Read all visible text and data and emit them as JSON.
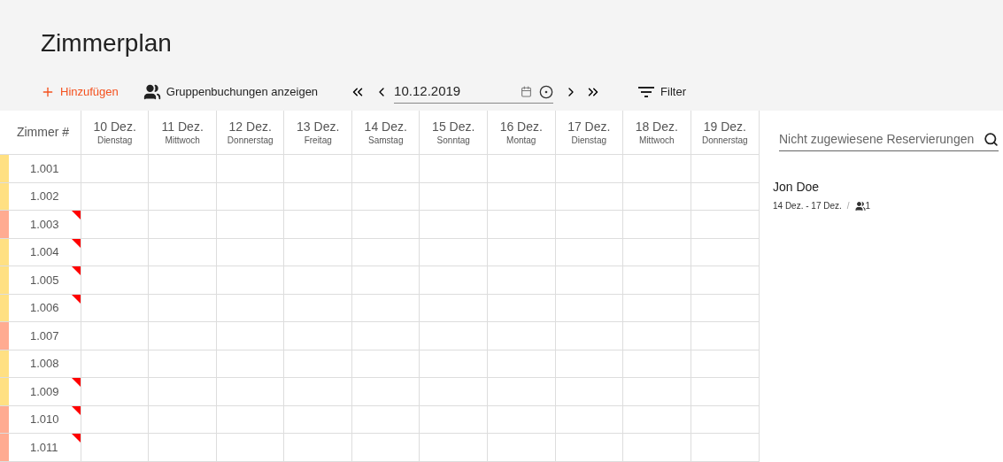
{
  "title": "Zimmerplan",
  "toolbar": {
    "add_label": "Hinzufügen",
    "group_label": "Gruppenbuchungen anzeigen",
    "date": "10.12.2019",
    "filter_label": "Filter"
  },
  "grid": {
    "room_header": "Zimmer #",
    "days": [
      {
        "date": "10 Dez.",
        "weekday": "Dienstag"
      },
      {
        "date": "11 Dez.",
        "weekday": "Mittwoch"
      },
      {
        "date": "12 Dez.",
        "weekday": "Donnerstag"
      },
      {
        "date": "13 Dez.",
        "weekday": "Freitag"
      },
      {
        "date": "14 Dez.",
        "weekday": "Samstag"
      },
      {
        "date": "15 Dez.",
        "weekday": "Sonntag"
      },
      {
        "date": "16 Dez.",
        "weekday": "Montag"
      },
      {
        "date": "17 Dez.",
        "weekday": "Dienstag"
      },
      {
        "date": "18 Dez.",
        "weekday": "Mittwoch"
      },
      {
        "date": "19 Dez.",
        "weekday": "Donnerstag"
      }
    ],
    "rooms": [
      {
        "number": "1.001",
        "color": "#ffe082",
        "flagged": false
      },
      {
        "number": "1.002",
        "color": "#ffe082",
        "flagged": false
      },
      {
        "number": "1.003",
        "color": "#ffab91",
        "flagged": true
      },
      {
        "number": "1.004",
        "color": "#ffe082",
        "flagged": true
      },
      {
        "number": "1.005",
        "color": "#ffe082",
        "flagged": true
      },
      {
        "number": "1.006",
        "color": "#ffe082",
        "flagged": true
      },
      {
        "number": "1.007",
        "color": "#ffab91",
        "flagged": false
      },
      {
        "number": "1.008",
        "color": "#ffe082",
        "flagged": false
      },
      {
        "number": "1.009",
        "color": "#ffe082",
        "flagged": true
      },
      {
        "number": "1.010",
        "color": "#ffab91",
        "flagged": true
      },
      {
        "number": "1.011",
        "color": "#ffab91",
        "flagged": true
      }
    ]
  },
  "unassigned": {
    "search_placeholder": "Nicht zugewiesene Reservierungen",
    "reservations": [
      {
        "name": "Jon Doe",
        "dates": "14 Dez. - 17 Dez.",
        "separator": "/",
        "guests": "1"
      }
    ]
  }
}
